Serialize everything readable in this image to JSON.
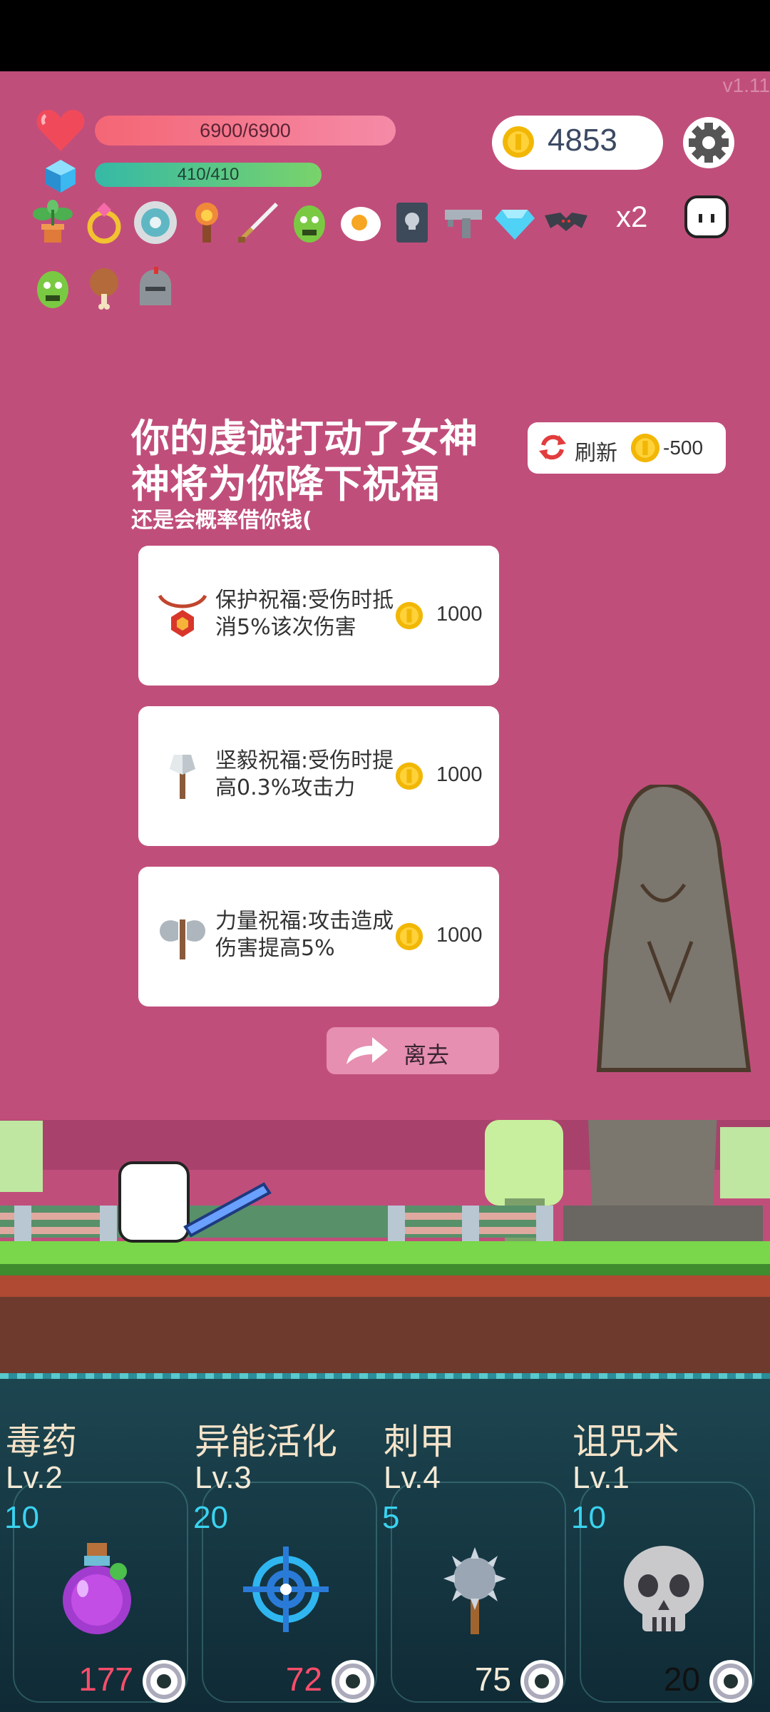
{
  "version": "v1.11",
  "hud": {
    "hp": "6900/6900",
    "mp": "410/410",
    "coins": "4853",
    "multiplier": "x2",
    "items_row1": [
      "plant-icon",
      "ring-icon",
      "shield-disc-icon",
      "torch-icon",
      "sword-icon",
      "goblin-icon",
      "egg-icon",
      "skull-book-icon",
      "gun-icon",
      "diamond-icon",
      "bat-icon"
    ],
    "items_row2": [
      "goblin-icon",
      "meat-icon",
      "helmet-icon"
    ]
  },
  "dialog": {
    "title_line1": "你的虔诚打动了女神",
    "title_line2": "神将为你降下祝福",
    "subtitle": "还是会概率借你钱(",
    "refresh_label": "刷新",
    "refresh_cost": "-500",
    "cards": [
      {
        "icon": "amulet-icon",
        "desc": "保护祝福:受伤时抵消5%该次伤害",
        "price": "1000"
      },
      {
        "icon": "axe-icon",
        "desc": "坚毅祝福:受伤时提高0.3%攻击力",
        "price": "1000"
      },
      {
        "icon": "battle-axe-icon",
        "desc": "力量祝福:攻击造成伤害提高5%",
        "price": "1000"
      }
    ],
    "leave_label": "离去"
  },
  "skills": [
    {
      "name": "毒药",
      "level": "Lv.2",
      "cost": "10",
      "count": "177",
      "count_color": "#ff4d6a",
      "icon": "potion-icon"
    },
    {
      "name": "异能活化",
      "level": "Lv.3",
      "cost": "20",
      "count": "72",
      "count_color": "#ff4d6a",
      "icon": "target-icon"
    },
    {
      "name": "刺甲",
      "level": "Lv.4",
      "cost": "5",
      "count": "75",
      "count_color": "#f3ead6",
      "icon": "spiked-mace-icon"
    },
    {
      "name": "诅咒术",
      "level": "Lv.1",
      "cost": "10",
      "count": "20",
      "count_color": "#111111",
      "icon": "skull-icon"
    }
  ]
}
